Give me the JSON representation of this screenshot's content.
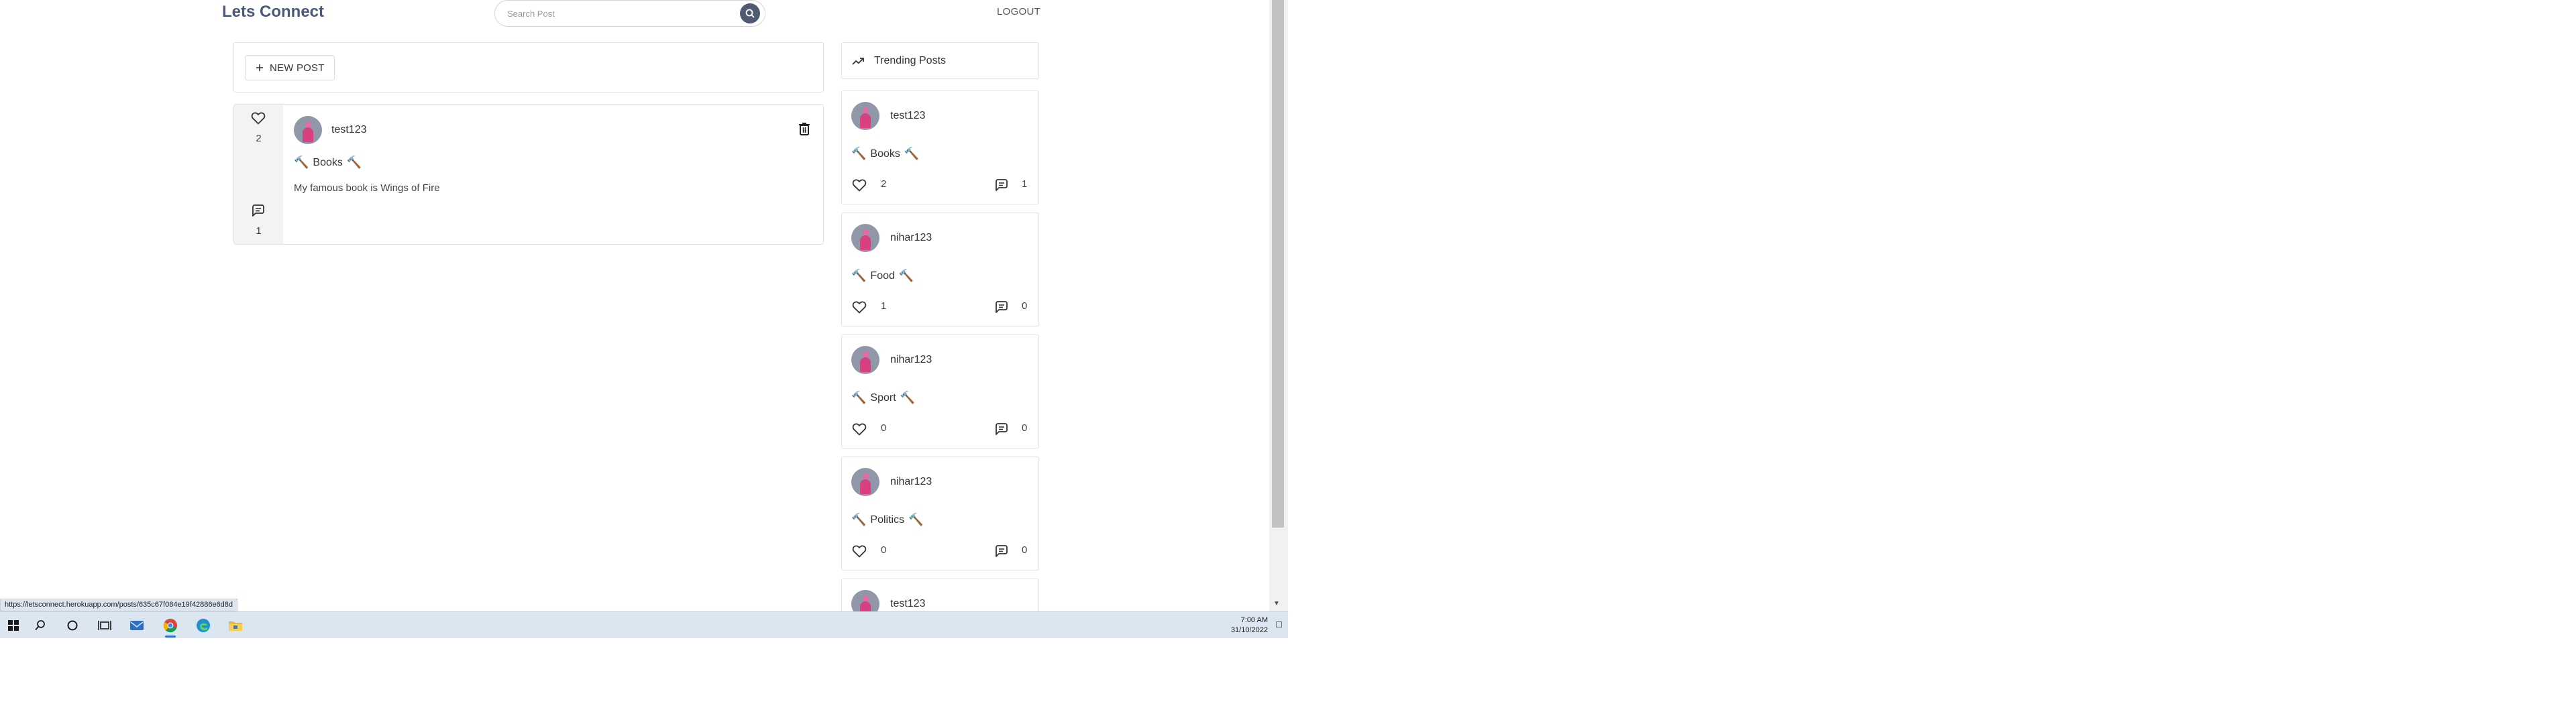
{
  "header": {
    "brand": "Lets Connect",
    "search_placeholder": "Search Post",
    "logout_label": "LOGOUT"
  },
  "composer": {
    "new_post_label": "NEW POST"
  },
  "post": {
    "likes": "2",
    "comments": "1",
    "username": "test123",
    "title": "Books",
    "body": "My famous book is Wings of Fire"
  },
  "trending": {
    "title": "Trending Posts",
    "items": [
      {
        "username": "test123",
        "title": "Books",
        "likes": "2",
        "comments": "1"
      },
      {
        "username": "nihar123",
        "title": "Food",
        "likes": "1",
        "comments": "0"
      },
      {
        "username": "nihar123",
        "title": "Sport",
        "likes": "0",
        "comments": "0"
      },
      {
        "username": "nihar123",
        "title": "Politics",
        "likes": "0",
        "comments": "0"
      },
      {
        "username": "test123"
      }
    ]
  },
  "status_url": "https://letsconnect.herokuapp.com/posts/635c67f084e19f42886e6d8d",
  "taskbar": {
    "time": "7:00 AM",
    "date": "31/10/2022",
    "icons": [
      "windows-start-icon",
      "search-icon",
      "cortana-icon",
      "task-view-icon",
      "mail-icon",
      "chrome-icon",
      "edge-icon",
      "file-explorer-icon"
    ]
  },
  "colors": {
    "brand": "#4a5a7a",
    "search_button": "#4f5b70",
    "vote_column": "#f3f3f3",
    "avatar_bg": "#8f97a8",
    "taskbar": "#dbe6f0"
  }
}
